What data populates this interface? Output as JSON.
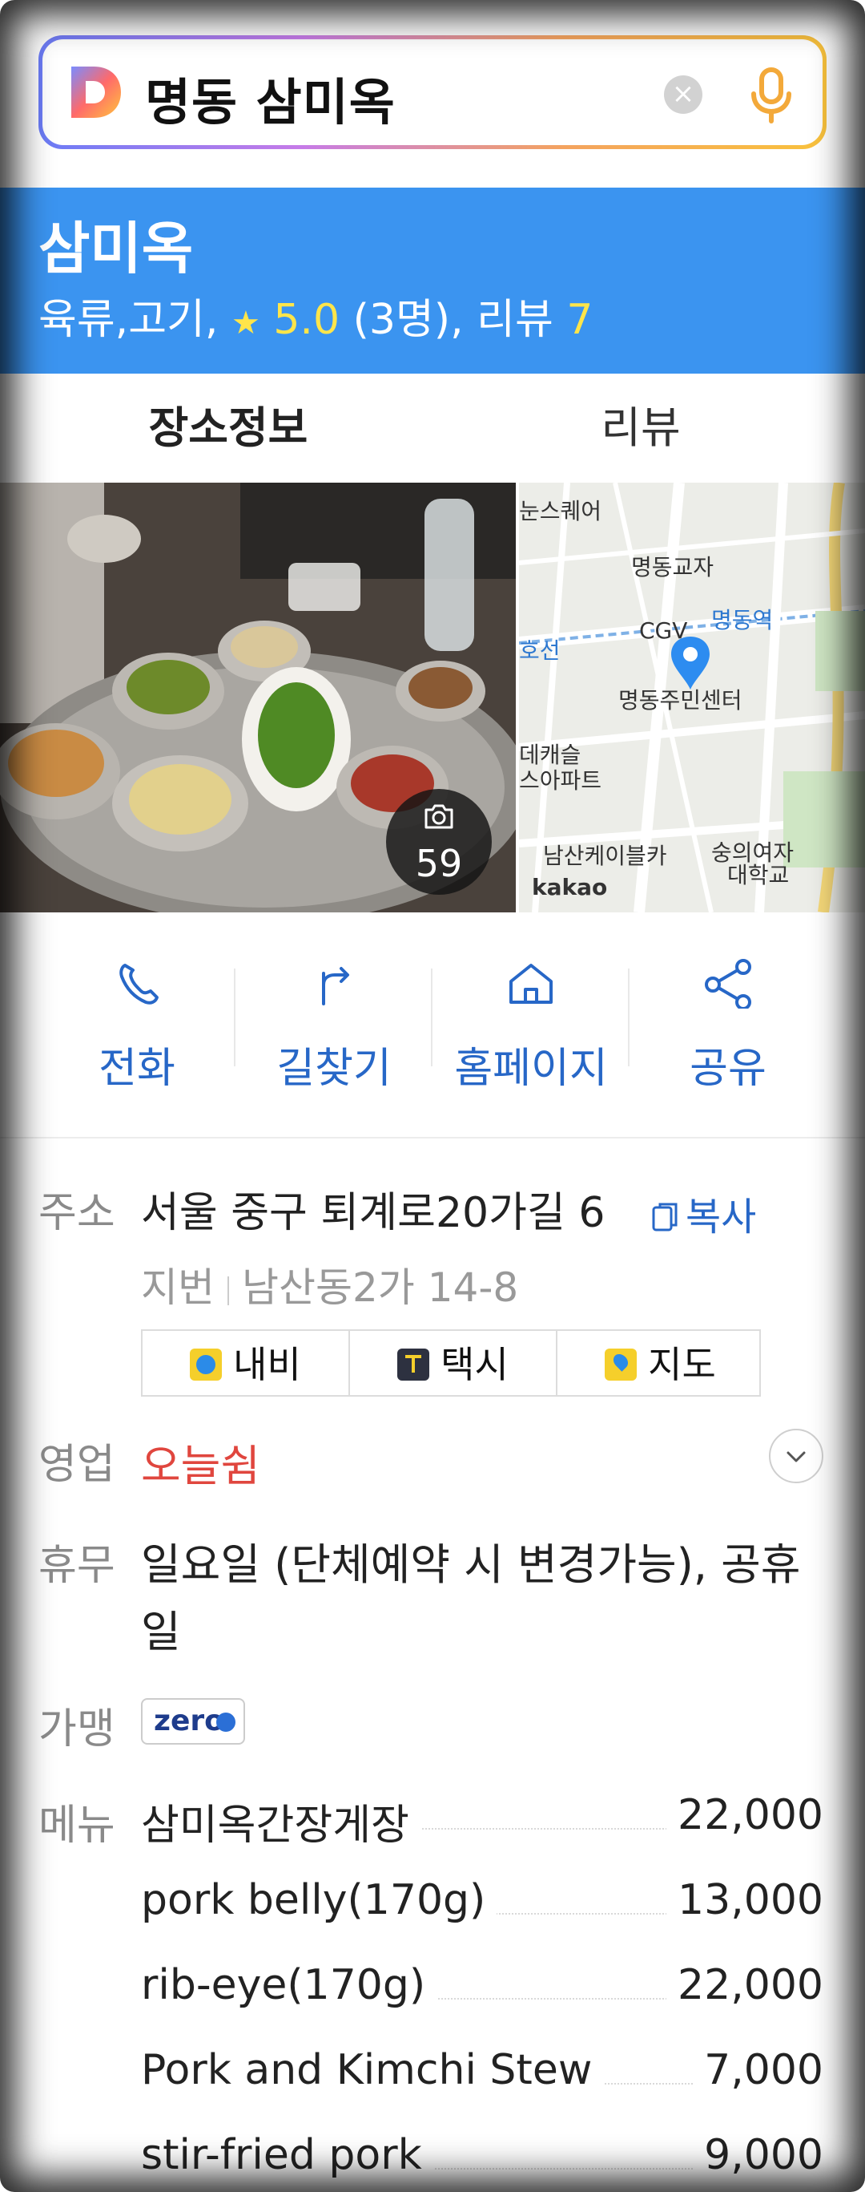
{
  "search": {
    "query": "명동 삼미옥",
    "clear_icon": "×"
  },
  "place": {
    "name": "삼미옥",
    "category": "육류,고기,",
    "rating": "5.0",
    "rating_count": "(3명),",
    "review_label": "리뷰",
    "review_count": "7"
  },
  "tabs": {
    "info": "장소정보",
    "review": "리뷰"
  },
  "photo": {
    "count": "59"
  },
  "map": {
    "labels": [
      "눈스퀘어",
      "명동교자",
      "CGV",
      "명동역",
      "명동주민센터",
      "데캐슬",
      "스아파트",
      "남산케이블카",
      "숭의여자",
      "대학교",
      "kakao",
      "호선"
    ]
  },
  "actions": {
    "call": "전화",
    "directions": "길찾기",
    "homepage": "홈페이지",
    "share": "공유"
  },
  "info": {
    "address_label": "주소",
    "address": "서울 중구 퇴계로20가길 6",
    "copy": "복사",
    "jibun_label": "지번",
    "jibun": "남산동2가 14-8",
    "navi": "내비",
    "taxi": "택시",
    "map": "지도",
    "hours_label": "영업",
    "hours_status": "오늘쉼",
    "holiday_label": "휴무",
    "holiday": "일요일 (단체예약 시 변경가능), 공휴일",
    "affiliate_label": "가맹",
    "zeropay": "zero",
    "menu_label": "메뉴"
  },
  "menu": [
    {
      "name": "삼미옥간장게장",
      "price": "22,000"
    },
    {
      "name": "pork belly(170g)",
      "price": "13,000"
    },
    {
      "name": "rib-eye(170g)",
      "price": "22,000"
    },
    {
      "name": "Pork and Kimchi Stew",
      "price": "7,000"
    },
    {
      "name": "stir-fried pork",
      "price": "9,000"
    }
  ],
  "colors": {
    "header_blue": "#3b94f0",
    "link_blue": "#2767c7",
    "closed_red": "#e0463e",
    "rating_yellow": "#ffe54a"
  }
}
